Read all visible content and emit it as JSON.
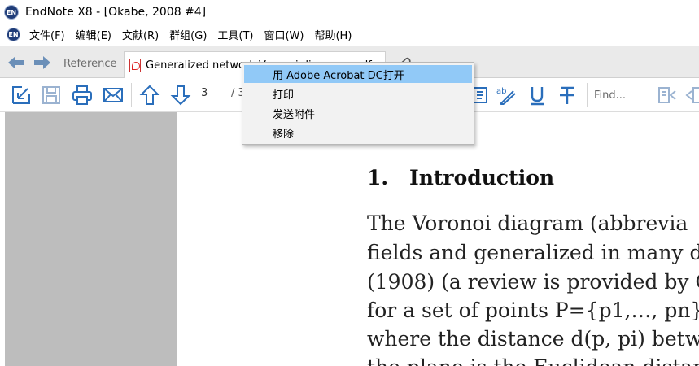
{
  "window": {
    "title": "EndNote X8 - [Okabe, 2008 #4]",
    "app_logo_text": "EN"
  },
  "menubar": {
    "items": [
      {
        "label": "文件(F)"
      },
      {
        "label": "编辑(E)"
      },
      {
        "label": "文献(R)"
      },
      {
        "label": "群组(G)"
      },
      {
        "label": "工具(T)"
      },
      {
        "label": "窗口(W)"
      },
      {
        "label": "帮助(H)"
      }
    ]
  },
  "tabs": {
    "reference_label": "Reference",
    "pdf_tab_label": "Generalized network Voronoi diagrams.pdf"
  },
  "toolbar": {
    "page_number": "3",
    "page_total_prefix": "/ 3",
    "find_placeholder": "Find..."
  },
  "context_menu": {
    "items": [
      {
        "label": "用 Adobe Acrobat DC打开",
        "highlighted": true
      },
      {
        "label": "打印"
      },
      {
        "label": "发送附件"
      },
      {
        "label": "移除"
      }
    ]
  },
  "document": {
    "heading_number": "1.",
    "heading_text": "Introduction",
    "lines": [
      "The Voronoi diagram (abbrevia",
      "fields and generalized in many d",
      "(1908) (a review is provided by C",
      "for a set of points P={p1,…, pn}",
      "where the distance d(p, pi) betwe",
      "the plane is the Euclidean distan"
    ]
  },
  "colors": {
    "menu_highlight": "#91c9f7",
    "toolbar_icon": "#2a6ebb",
    "nav_arrow": "#6b8fb8",
    "gray_margin": "#bdbdbd"
  }
}
